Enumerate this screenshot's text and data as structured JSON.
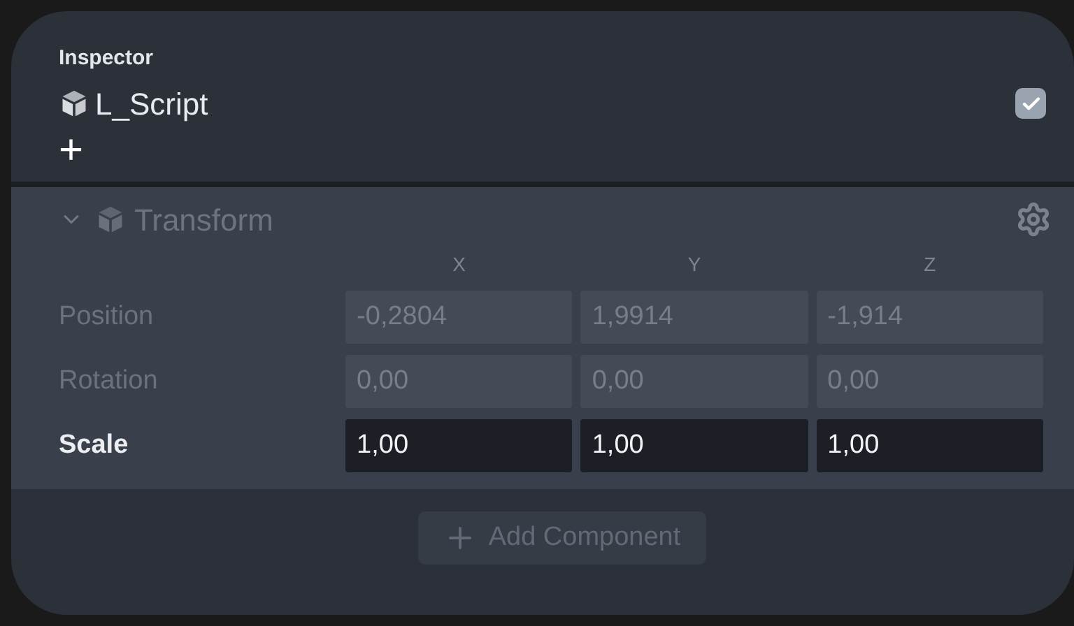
{
  "inspector": {
    "title": "Inspector",
    "object_name": "L_Script",
    "enabled": true,
    "add_symbol": "+"
  },
  "component": {
    "name": "Transform",
    "expanded": true,
    "disabled": true,
    "axes": [
      "X",
      "Y",
      "Z"
    ],
    "rows": [
      {
        "label": "Position",
        "disabled": true,
        "values": [
          "-0,2804",
          "1,9914",
          "-1,914"
        ]
      },
      {
        "label": "Rotation",
        "disabled": true,
        "values": [
          "0,00",
          "0,00",
          "0,00"
        ]
      },
      {
        "label": "Scale",
        "disabled": false,
        "values": [
          "1,00",
          "1,00",
          "1,00"
        ]
      }
    ]
  },
  "add_component": {
    "label": "Add Component",
    "disabled": true
  }
}
